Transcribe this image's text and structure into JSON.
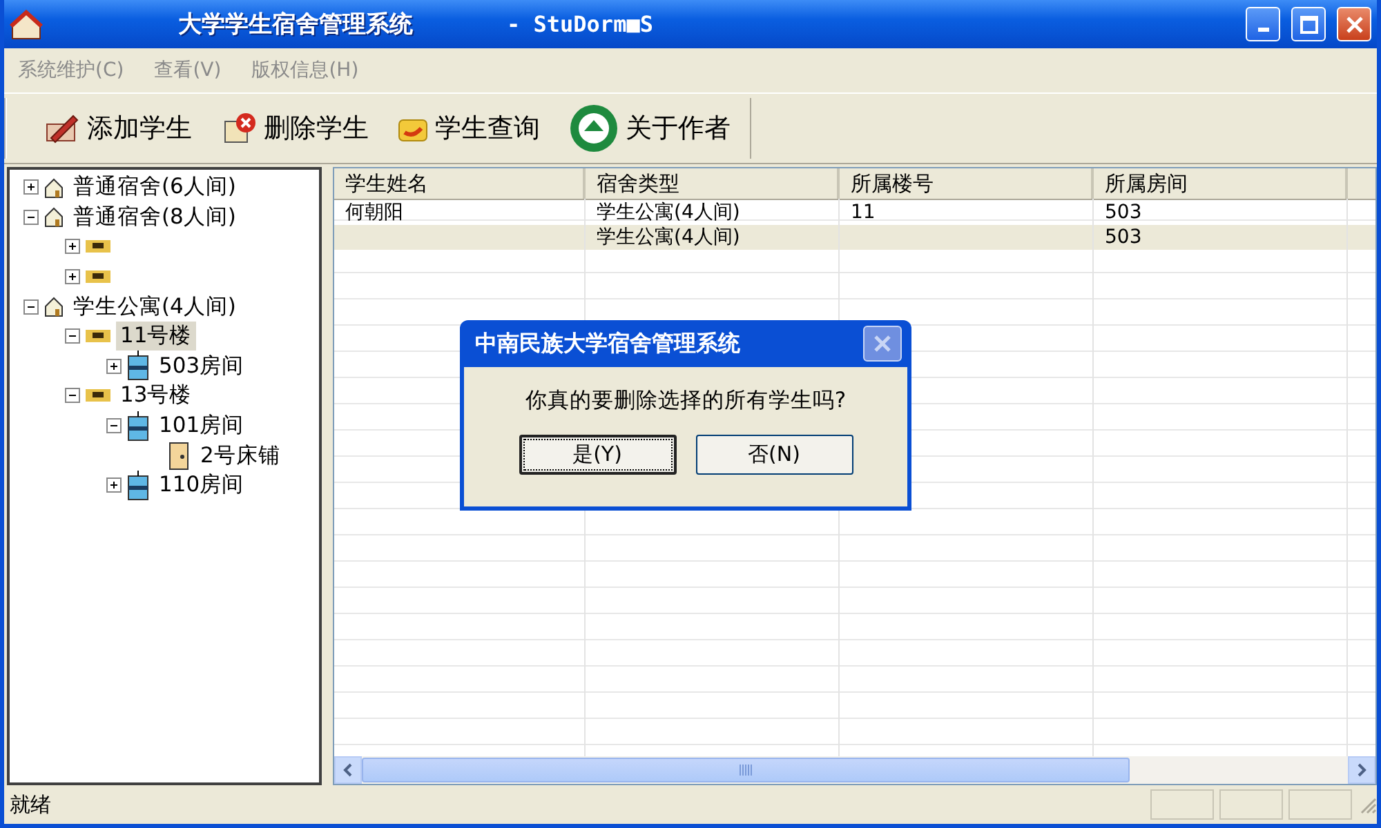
{
  "window": {
    "title": "大学学生宿舍管理系统",
    "subtitle": "- StuDorm■S"
  },
  "menu": [
    {
      "label": "系统维护(C)"
    },
    {
      "label": "查看(V)"
    },
    {
      "label": "版权信息(H)"
    }
  ],
  "toolbar": [
    {
      "label": "添加学生",
      "kind": "add"
    },
    {
      "label": "删除学生",
      "kind": "delete"
    },
    {
      "label": "学生查询",
      "kind": "query"
    },
    {
      "label": "关于作者",
      "kind": "about"
    }
  ],
  "tree": [
    {
      "label": "普通宿舍(6人间)",
      "kind": "building",
      "expanded": false,
      "selected": false
    },
    {
      "label": "普通宿舍(8人间)",
      "kind": "building",
      "expanded": true,
      "selected": false,
      "children": [
        {
          "kind": "floor",
          "expanded": false
        },
        {
          "kind": "floor",
          "expanded": false
        }
      ]
    },
    {
      "label": "学生公寓(4人间)",
      "kind": "building",
      "expanded": true,
      "selected": false,
      "children": [
        {
          "label": "11号楼",
          "kind": "floor",
          "expanded": true,
          "selected": true,
          "children": [
            {
              "label": "503房间",
              "kind": "room",
              "expanded": false,
              "selected": false
            }
          ]
        },
        {
          "label": "13号楼",
          "kind": "floor",
          "expanded": true,
          "selected": false,
          "children": [
            {
              "label": "101房间",
              "kind": "room",
              "expanded": true,
              "selected": false,
              "children": [
                {
                  "label": "2号床铺",
                  "kind": "bed",
                  "selected": false
                }
              ]
            },
            {
              "label": "110房间",
              "kind": "room",
              "expanded": false,
              "selected": false
            }
          ]
        }
      ]
    }
  ],
  "table": {
    "columns": [
      "学生姓名",
      "宿舍类型",
      "所属楼号",
      "所属房间"
    ],
    "rows": [
      {
        "cells": [
          "何朝阳",
          "学生公寓(4人间)",
          "11",
          "503"
        ],
        "selected": false
      },
      {
        "cells": [
          "",
          "学生公寓(4人间)",
          "",
          "503"
        ],
        "selected": true
      }
    ]
  },
  "dialog": {
    "title": "中南民族大学宿舍管理系统",
    "message": "你真的要删除选择的所有学生吗?",
    "buttons": [
      {
        "label": "是(Y)",
        "focused": true
      },
      {
        "label": "否(N)",
        "focused": false
      }
    ]
  },
  "status_bar": {
    "text": "就绪"
  }
}
